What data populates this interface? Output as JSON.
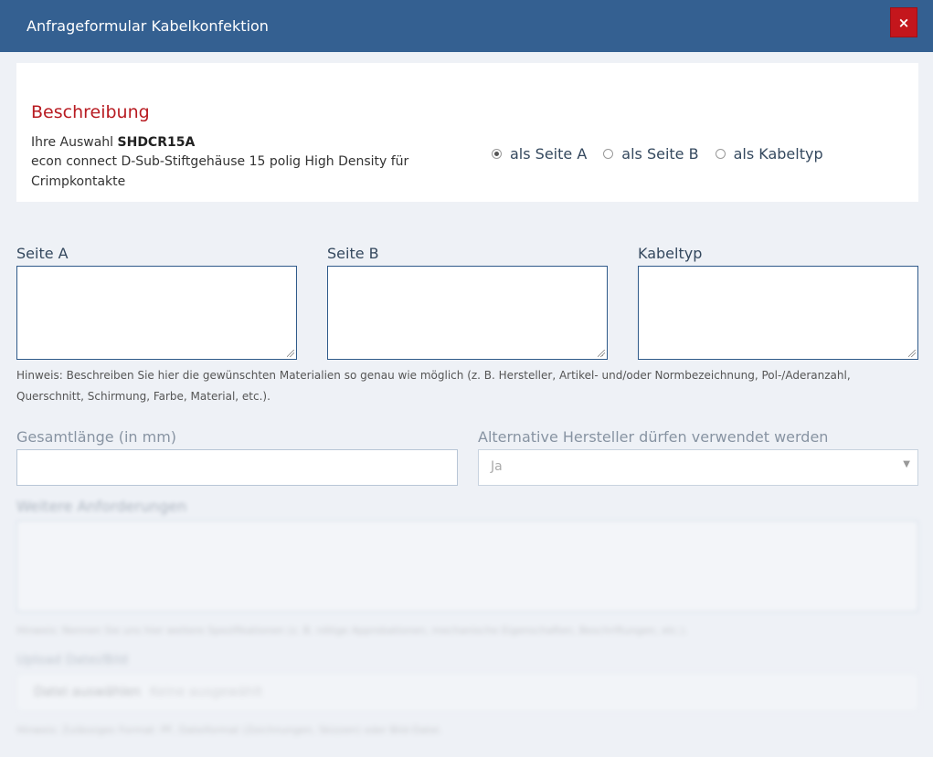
{
  "dialog": {
    "title": "Anfrageformular Kabelkonfektion",
    "close_icon": "×"
  },
  "description": {
    "heading": "Beschreibung",
    "selection_prefix": "Ihre Auswahl",
    "selection_code": "SHDCR15A",
    "product_text": "econ connect D-Sub-Stiftgehäuse 15 polig High Density für Crimpkontakte",
    "radio_options": [
      {
        "label": "als Seite A",
        "checked": true
      },
      {
        "label": "als Seite B",
        "checked": false
      },
      {
        "label": "als Kabeltyp",
        "checked": false
      }
    ]
  },
  "fields": {
    "side_a_label": "Seite A",
    "side_b_label": "Seite B",
    "cable_type_label": "Kabeltyp",
    "hint": "Hinweis: Beschreiben Sie hier die gewünschten Materialien so genau wie möglich (z. B. Hersteller, Artikel- und/oder Normbezeichnung, Pol-/Aderanzahl, Querschnitt, Schirmung, Farbe, Material, etc.).",
    "total_length_label": "Gesamtlänge (in mm)",
    "alt_manufacturer_label": "Alternative Hersteller dürfen verwendet werden",
    "alt_manufacturer_value": "Ja",
    "more_requirements_label": "Weitere Anforderungen",
    "more_requirements_hint": "Hinweis: Nennen Sie uns hier weitere Spezifikationen (z. B. nötige Approbationen, mechanische Eigenschaften, Beschriftungen, etc.).",
    "upload_label": "Upload Datei/Bild",
    "upload_button": "Datei auswählen",
    "upload_none": "Keine ausgewählt",
    "upload_hint": "Hinweis: Zulässiges Format: PF, Dateiformat (Zeichnungen, Skizzen) oder Bild-Datei."
  },
  "colors": {
    "titlebar": "#346091",
    "close_button": "#c4161c",
    "heading_red": "#b81c22"
  }
}
